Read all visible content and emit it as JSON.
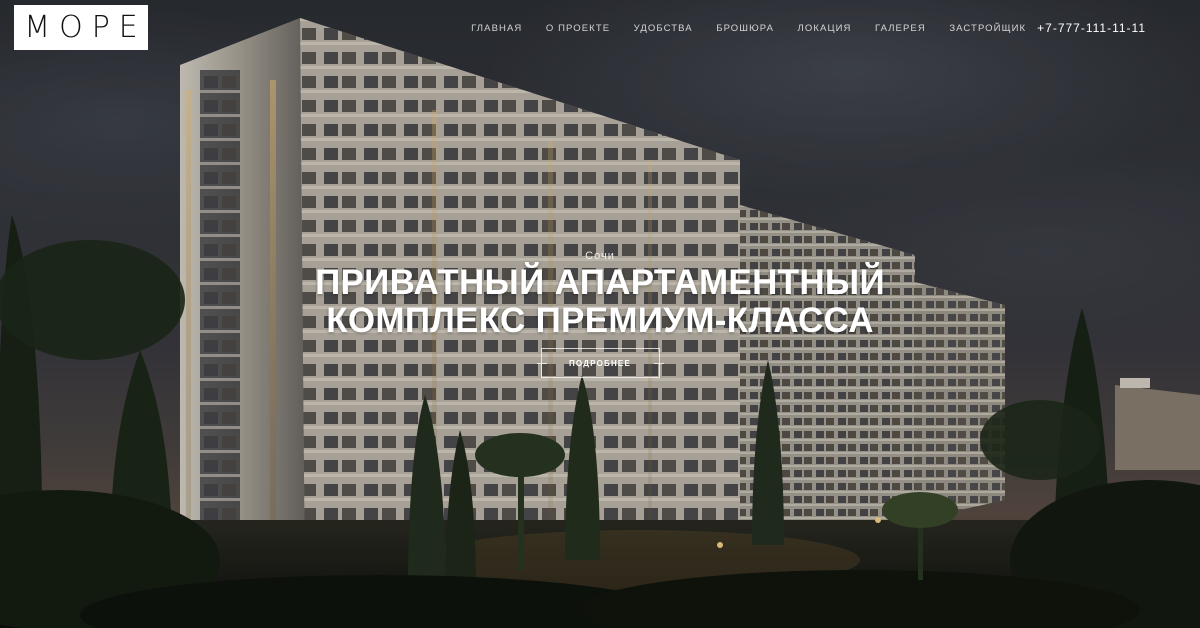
{
  "brand": {
    "logo_text": "МОРЕ"
  },
  "nav": {
    "items": [
      "ГЛАВНАЯ",
      "О ПРОЕКТЕ",
      "УДОБСТВА",
      "БРОШЮРА",
      "ЛОКАЦИЯ",
      "ГАЛЕРЕЯ",
      "ЗАСТРОЙЩИК"
    ],
    "phone": "+7-777-111-11-11"
  },
  "hero": {
    "city": "Сочи",
    "title_line1": "ПРИВАТНЫЙ АПАРТАМЕНТНЫЙ",
    "title_line2": "КОМПЛЕКС ПРЕМИУМ-КЛАССА",
    "button_label": "ПОДРОБНЕЕ"
  }
}
